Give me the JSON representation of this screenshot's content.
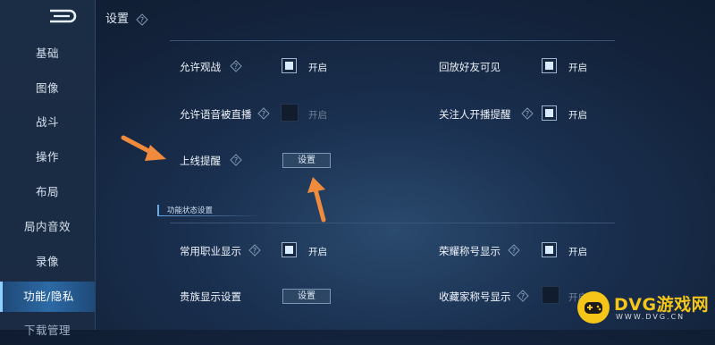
{
  "header": {
    "title": "设置"
  },
  "sidebar": {
    "items": [
      {
        "label": "基础"
      },
      {
        "label": "图像"
      },
      {
        "label": "战斗"
      },
      {
        "label": "操作"
      },
      {
        "label": "布局"
      },
      {
        "label": "局内音效"
      },
      {
        "label": "录像"
      },
      {
        "label": "功能/隐私",
        "active": true
      },
      {
        "label": "下载管理"
      }
    ]
  },
  "settings": {
    "allow_spectate": {
      "label": "允许观战",
      "state": "开启",
      "checked": true
    },
    "replay_friends": {
      "label": "回放好友可见",
      "state": "开启",
      "checked": true
    },
    "voice_broadcast": {
      "label": "允许语音被直播",
      "state": "开启",
      "checked": false
    },
    "follow_live": {
      "label": "关注人开播提醒",
      "state": "开启",
      "checked": true
    },
    "online_reminder": {
      "label": "上线提醒",
      "button": "设置"
    }
  },
  "section": {
    "title": "功能状态设置"
  },
  "status_settings": {
    "common_role": {
      "label": "常用职业显示",
      "state": "开启",
      "checked": true
    },
    "honor_title": {
      "label": "荣耀称号显示",
      "state": "开启",
      "checked": true
    },
    "noble_display": {
      "label": "贵族显示设置",
      "button": "设置"
    },
    "collector_title": {
      "label": "收藏家称号显示",
      "state": "开启",
      "checked": false
    }
  },
  "watermark": {
    "brand": "DVG游戏网",
    "url": "WWW.DVG.CN"
  },
  "colors": {
    "accent": "#2c6aa6",
    "arrow": "#f08a3c",
    "logo": "#f5c518"
  }
}
